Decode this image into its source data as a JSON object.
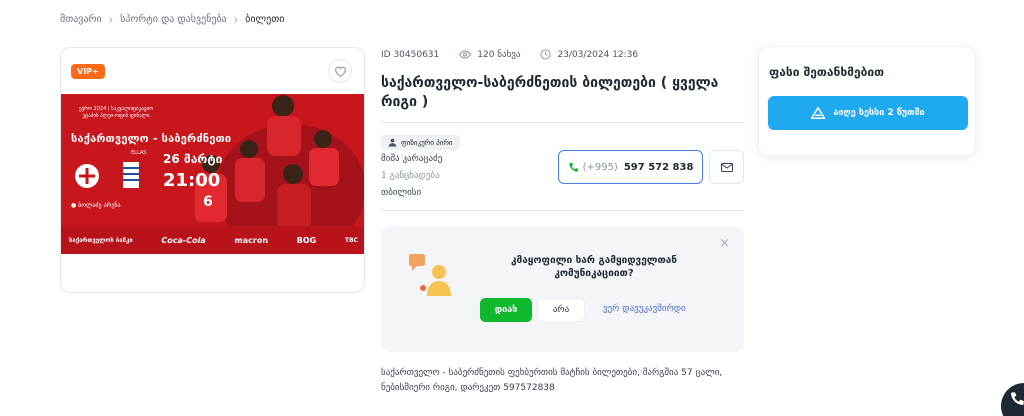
{
  "breadcrumb": {
    "items": [
      "მთავარი",
      "სპორტი და დასვენება",
      "ბილეთი"
    ]
  },
  "listing": {
    "vip_label": "VIP+",
    "id_text": "ID 30450631",
    "views": "120 ნახვა",
    "date": "23/03/2024 12:36",
    "title": "საქართველო-საბერძნეთის ბილეთები ( ყველა რიგი )",
    "description": "საქართველო - საბერძნეთის ფეხბურთის მატჩის ბილეთები, მარგშია 57 ცალი, ნებისმიერი რიგი, დარეკეთ 597572838"
  },
  "banner": {
    "small_title": "ევრო 2024 | საკვალიფიკაციო ეტაპის პლეი-ოფის ფინალი",
    "match": "საქართველო - საბერძნეთი",
    "date": "26 მარტი",
    "time": "21:00",
    "venue": "ბოლაძე არენა",
    "small_label": "ELLAS",
    "sponsors": [
      "საქართველოს ბანკი",
      "Coca-Cola",
      "macron",
      "BOG",
      "TBC"
    ]
  },
  "seller": {
    "badge": "ფიზიკური პირი",
    "name": "მიშა კარაცაძე",
    "ads_count": "1 განცხადება",
    "city": "თბილისი"
  },
  "contact": {
    "prefix": "(+995)",
    "phone": "597 572 838"
  },
  "survey": {
    "question": "კმაყოფილი ხარ გამყიდველთან კომუნიკაციით?",
    "yes": "დიახ",
    "no": "არა",
    "cant": "ვერ დავუკავშირდი",
    "close": "×"
  },
  "price_panel": {
    "heading": "ფასი შეთანხმებით",
    "button": "აიღე სესხი 2 წუთში"
  },
  "colors": {
    "vip": "#ff6a1a",
    "banner_red": "#c8161d",
    "phone_border": "#4a7de2",
    "yes_green": "#10b82e",
    "loan_blue": "#1faaf0"
  }
}
